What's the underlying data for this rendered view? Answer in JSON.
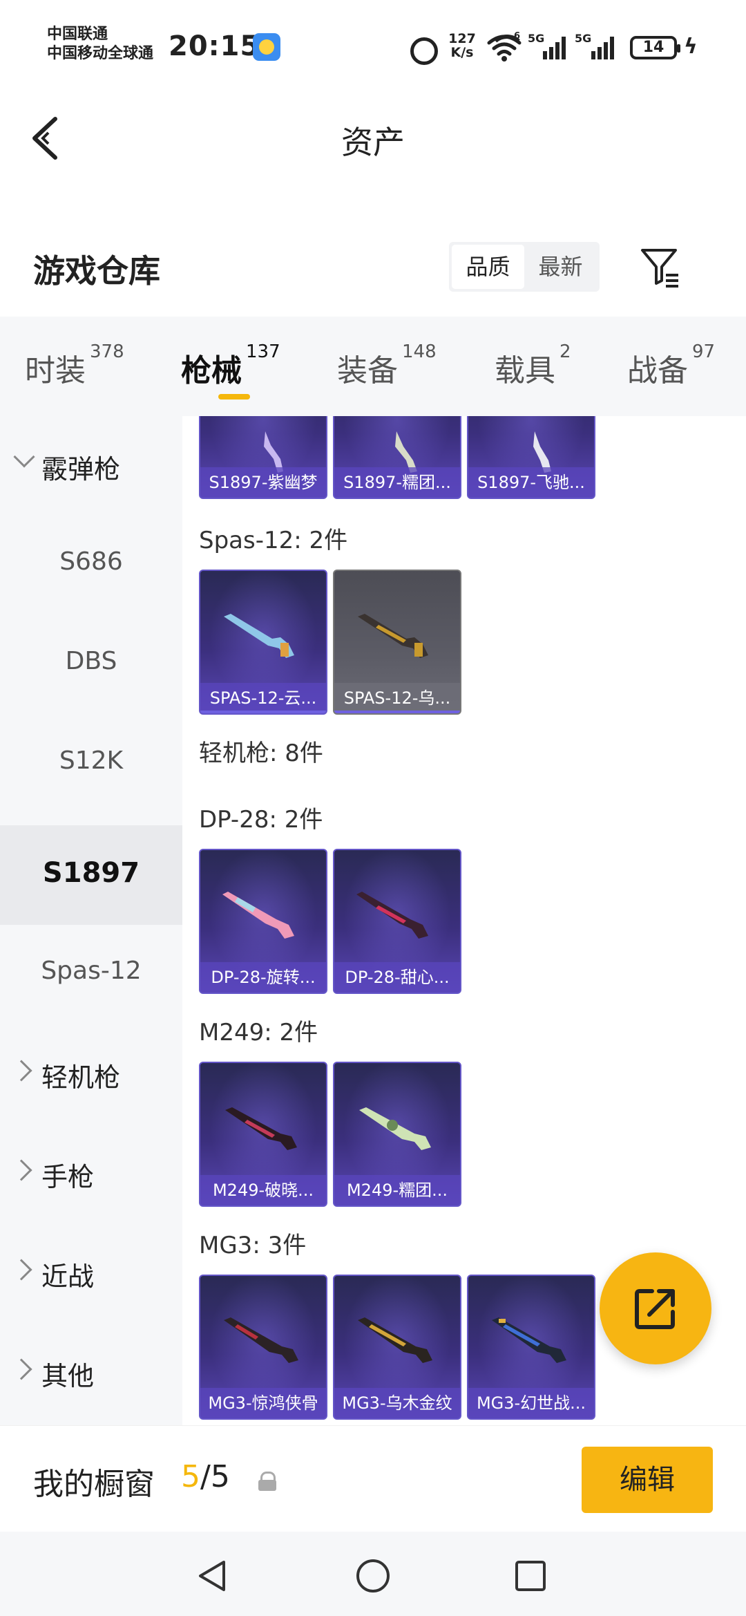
{
  "status_bar": {
    "carrier_1": "中国联通",
    "carrier_2": "中国移动全球通",
    "time": "20:15",
    "net_speed_value": "127",
    "net_speed_unit": "K/s",
    "signal_1": "5G",
    "signal_2": "5G",
    "wifi_tag": "6",
    "battery": "14"
  },
  "nav": {
    "title": "资产"
  },
  "section": {
    "title": "游戏仓库",
    "sort_options": [
      "品质",
      "最新"
    ],
    "sort_active": "品质"
  },
  "tabs": [
    {
      "label": "时装",
      "count": "378"
    },
    {
      "label": "枪械",
      "count": "137",
      "active": true
    },
    {
      "label": "装备",
      "count": "148"
    },
    {
      "label": "载具",
      "count": "2"
    },
    {
      "label": "战备",
      "count": "97"
    }
  ],
  "sidebar": {
    "items": [
      {
        "label": "霰弹枪",
        "type": "category",
        "expanded": true
      },
      {
        "label": "S686",
        "type": "sub"
      },
      {
        "label": "DBS",
        "type": "sub"
      },
      {
        "label": "S12K",
        "type": "sub"
      },
      {
        "label": "S1897",
        "type": "sub",
        "selected": true
      },
      {
        "label": "Spas-12",
        "type": "sub"
      },
      {
        "label": "轻机枪",
        "type": "category"
      },
      {
        "label": "手枪",
        "type": "category"
      },
      {
        "label": "近战",
        "type": "category"
      },
      {
        "label": "其他",
        "type": "category"
      }
    ]
  },
  "content": {
    "partial_row": [
      {
        "name": "S1897-紫幽梦"
      },
      {
        "name": "S1897-糯团..."
      },
      {
        "name": "S1897-飞驰..."
      }
    ],
    "groups": [
      {
        "title": "Spas-12: 2件",
        "items": [
          {
            "name": "SPAS-12-云...",
            "color": "#8fc7e8"
          },
          {
            "name": "SPAS-12-乌...",
            "color": "#c89a2e",
            "grey": true
          }
        ]
      },
      {
        "title": "轻机枪: 8件",
        "items": []
      },
      {
        "title": "DP-28: 2件",
        "items": [
          {
            "name": "DP-28-旋转...",
            "color": "#f09ab8"
          },
          {
            "name": "DP-28-甜心...",
            "color": "#d2335c"
          }
        ]
      },
      {
        "title": "M249: 2件",
        "items": [
          {
            "name": "M249-破晓...",
            "color": "#c43b5a"
          },
          {
            "name": "M249-糯团...",
            "color": "#cfe3b5"
          }
        ]
      },
      {
        "title": "MG3: 3件",
        "items": [
          {
            "name": "MG3-惊鸿侠骨",
            "color": "#b8313f"
          },
          {
            "name": "MG3-乌木金纹",
            "color": "#d3a53a"
          },
          {
            "name": "MG3-幻世战...",
            "color": "#3f6fd6"
          }
        ]
      }
    ]
  },
  "showcase": {
    "title": "我的橱窗",
    "current": "5",
    "separator": "/",
    "total": "5",
    "edit_label": "编辑"
  },
  "colors": {
    "accent": "#f7b512",
    "card_purple": "#3b2f7d",
    "sidebar_bg": "#f6f7f9"
  }
}
